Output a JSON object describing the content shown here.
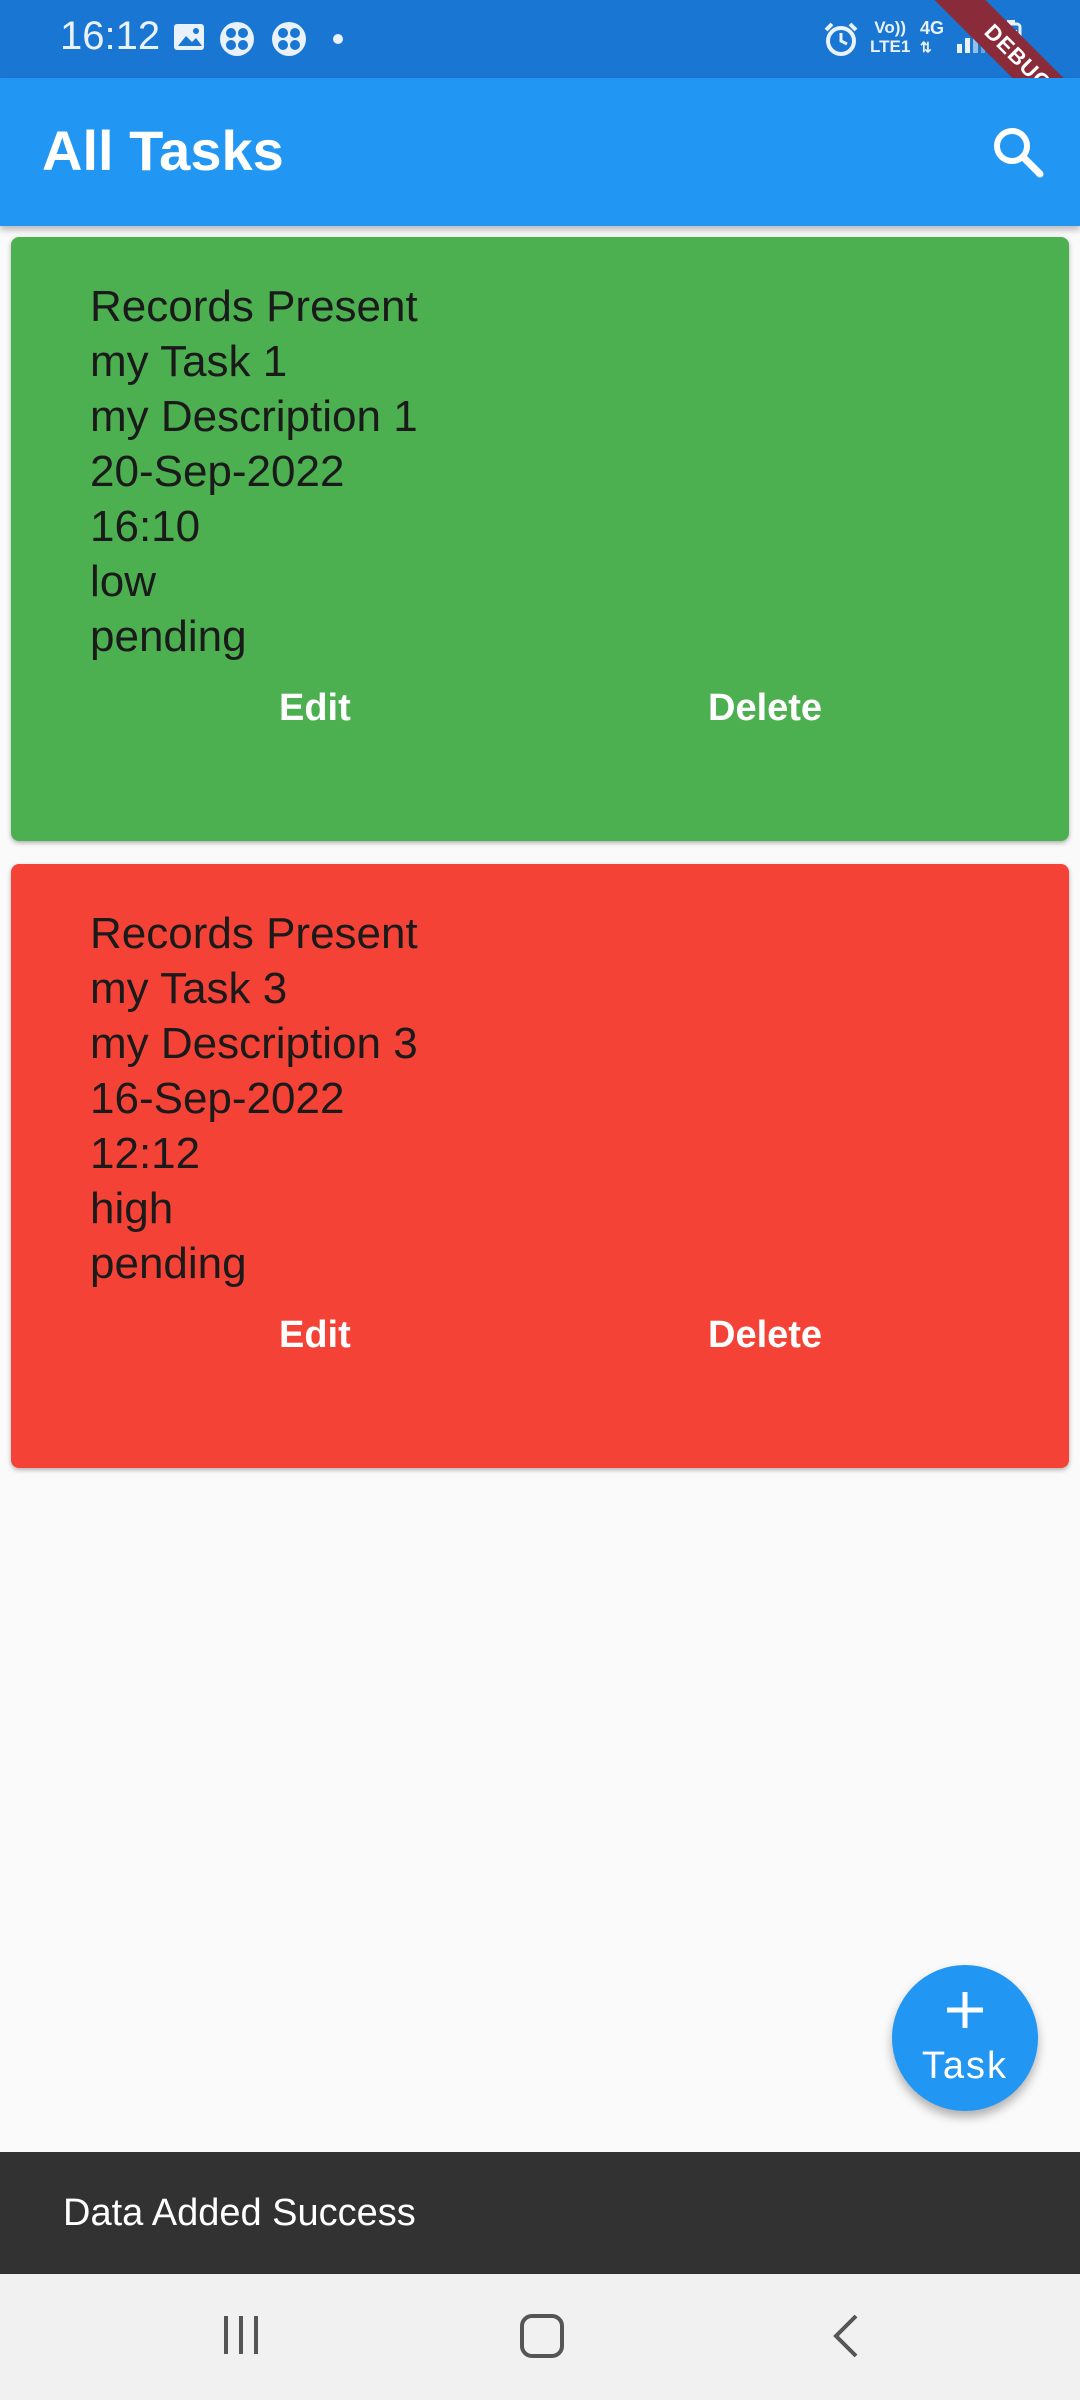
{
  "status_bar": {
    "time": "16:12",
    "icons": [
      "gallery-icon",
      "fan-icon",
      "fan-icon",
      "dot-icon",
      "alarm-icon",
      "volte-icon",
      "4g-icon",
      "signal-icon",
      "battery-icon"
    ],
    "network_top": "Vo))",
    "network_bottom": "LTE1",
    "network_type": "4G",
    "debug_label": "DEBUG"
  },
  "app_bar": {
    "title": "All Tasks",
    "color": "#2196f3"
  },
  "tasks": [
    {
      "lines": [
        "Records Present",
        "my Task 1",
        "my Description 1",
        "20-Sep-2022",
        "16:10",
        "low",
        "pending"
      ],
      "color": "#4caf50",
      "edit_label": "Edit",
      "delete_label": "Delete"
    },
    {
      "lines": [
        "Records Present",
        "my Task 3",
        "my Description 3",
        "16-Sep-2022",
        "12:12",
        "high",
        "pending"
      ],
      "color": "#f44336",
      "edit_label": "Edit",
      "delete_label": "Delete"
    }
  ],
  "fab": {
    "label": "Task",
    "icon": "plus-icon"
  },
  "snackbar": {
    "message": "Data Added Success"
  },
  "nav": {
    "icons": [
      "recent-apps-icon",
      "home-icon",
      "back-icon"
    ]
  }
}
